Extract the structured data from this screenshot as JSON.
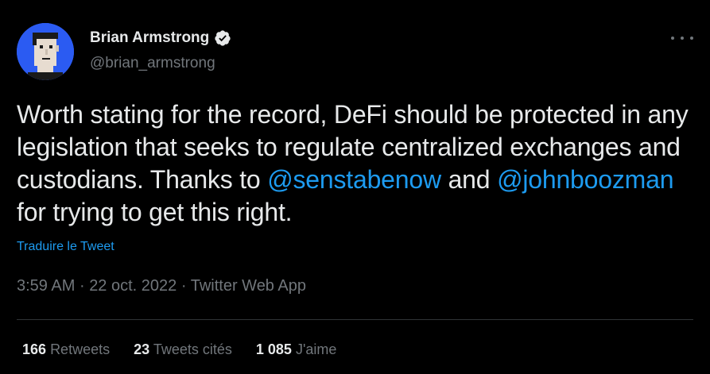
{
  "author": {
    "display_name": "Brian Armstrong",
    "handle": "@brian_armstrong",
    "avatar_icon": "pixel-punk-avatar-icon",
    "verified_icon": "verified-badge-icon"
  },
  "tweet": {
    "text_part1": "Worth stating for the record, DeFi should be protected in any legislation that seeks to regulate centralized exchanges and custodians. Thanks to ",
    "mention1": "@senstabenow",
    "text_part2": " and ",
    "mention2": "@johnboozman",
    "text_part3": " for trying to get this right.",
    "translate_label": "Traduire le Tweet",
    "time": "3:59 AM",
    "separator1": "·",
    "date": "22 oct. 2022",
    "separator2": "·",
    "source": "Twitter Web App"
  },
  "stats": {
    "retweets_count": "166",
    "retweets_label": "Retweets",
    "quotes_count": "23",
    "quotes_label": "Tweets cités",
    "likes_count": "1 085",
    "likes_label": "J'aime"
  },
  "menu": {
    "icon": "more-options-icon"
  },
  "colors": {
    "background": "#000000",
    "text_primary": "#e7e9ea",
    "text_secondary": "#71767b",
    "link": "#1d9bf0",
    "divider": "#2f3336",
    "avatar_bg": "#2b5bf2"
  }
}
